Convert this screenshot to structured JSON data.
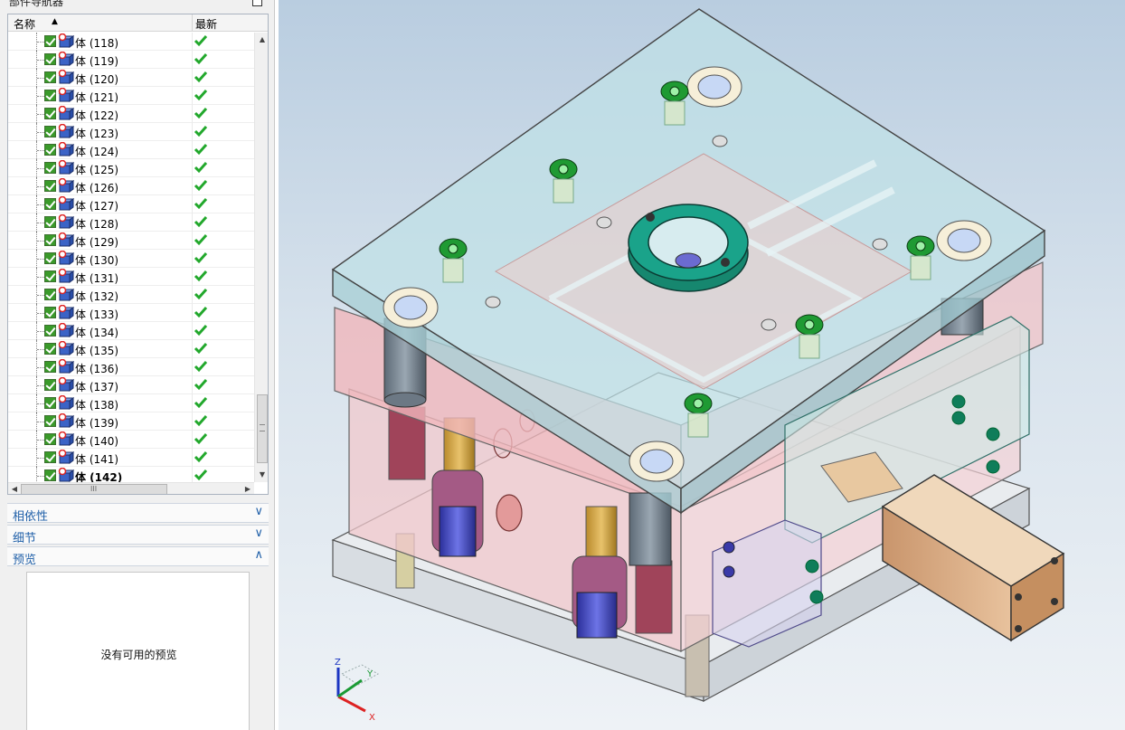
{
  "navigator": {
    "title": "部件导航器",
    "column_name": "名称",
    "column_latest": "最新",
    "rows": [
      {
        "label": "体 (118)",
        "bold": false
      },
      {
        "label": "体 (119)",
        "bold": false
      },
      {
        "label": "体 (120)",
        "bold": false
      },
      {
        "label": "体 (121)",
        "bold": false
      },
      {
        "label": "体 (122)",
        "bold": false
      },
      {
        "label": "体 (123)",
        "bold": false
      },
      {
        "label": "体 (124)",
        "bold": false
      },
      {
        "label": "体 (125)",
        "bold": false
      },
      {
        "label": "体 (126)",
        "bold": false
      },
      {
        "label": "体 (127)",
        "bold": false
      },
      {
        "label": "体 (128)",
        "bold": false
      },
      {
        "label": "体 (129)",
        "bold": false
      },
      {
        "label": "体 (130)",
        "bold": false
      },
      {
        "label": "体 (131)",
        "bold": false
      },
      {
        "label": "体 (132)",
        "bold": false
      },
      {
        "label": "体 (133)",
        "bold": false
      },
      {
        "label": "体 (134)",
        "bold": false
      },
      {
        "label": "体 (135)",
        "bold": false
      },
      {
        "label": "体 (136)",
        "bold": false
      },
      {
        "label": "体 (137)",
        "bold": false
      },
      {
        "label": "体 (138)",
        "bold": false
      },
      {
        "label": "体 (139)",
        "bold": false
      },
      {
        "label": "体 (140)",
        "bold": false
      },
      {
        "label": "体 (141)",
        "bold": false
      },
      {
        "label": "体 (142)",
        "bold": true
      }
    ],
    "hscroll_grip": "III"
  },
  "sections": {
    "dependencies": "相依性",
    "details": "细节",
    "preview": "预览",
    "preview_empty": "没有可用的预览"
  },
  "viewport": {
    "triad": {
      "x": "X",
      "y": "Y",
      "z": "Z"
    }
  },
  "colors": {
    "accent": "#1f5fa8",
    "check_green": "#3a9a2a",
    "top_plate": "#bfe0e6",
    "cavity_plate": "#f2b9bd",
    "ring": "#1aa38a",
    "cylinder": "#d9a86a"
  }
}
